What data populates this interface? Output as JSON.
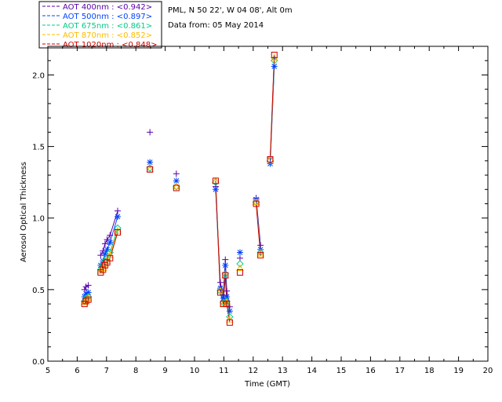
{
  "header": {
    "site": "PML, N 50 22', W 04 08', Alt 0m",
    "date_line": "Data from: 05 May 2014"
  },
  "legend": [
    {
      "label": "AOT  400nm : <0.942>",
      "color": "#5500aa"
    },
    {
      "label": "AOT  500nm : <0.897>",
      "color": "#0044ff"
    },
    {
      "label": "AOT  675nm : <0.861>",
      "color": "#00cc88"
    },
    {
      "label": "AOT  870nm : <0.852>",
      "color": "#ffbb00"
    },
    {
      "label": "AOT 1020nm : <0.848>",
      "color": "#cc0000"
    }
  ],
  "chart_data": {
    "type": "line",
    "xlabel": "Time (GMT)",
    "ylabel": "Aerosol Optical Thickness",
    "xlim": [
      5,
      20
    ],
    "ylim": [
      0.0,
      2.2
    ],
    "xticks": [
      "5",
      "6",
      "7",
      "8",
      "9",
      "10",
      "11",
      "12",
      "13",
      "14",
      "15",
      "16",
      "17",
      "18",
      "19",
      "20"
    ],
    "yticks": [
      "0.0",
      "0.5",
      "1.0",
      "1.5",
      "2.0"
    ],
    "series": [
      {
        "name": "AOT  400nm",
        "marker": "plus",
        "x": [
          6.25,
          6.3,
          6.38,
          6.8,
          6.88,
          6.95,
          7.02,
          7.12,
          7.38,
          8.48,
          9.38,
          10.72,
          10.88,
          10.98,
          11.05,
          11.1,
          11.2,
          11.55,
          12.1,
          12.25,
          12.58,
          12.72
        ],
        "y": [
          0.5,
          0.52,
          0.53,
          0.74,
          0.77,
          0.82,
          0.85,
          0.88,
          1.05,
          1.6,
          1.31,
          1.22,
          0.55,
          0.46,
          0.71,
          0.49,
          0.38,
          0.72,
          1.14,
          0.81,
          1.42,
          2.12
        ]
      },
      {
        "name": "AOT  500nm",
        "marker": "star",
        "x": [
          6.25,
          6.3,
          6.38,
          6.8,
          6.88,
          6.95,
          7.02,
          7.12,
          7.38,
          8.48,
          9.38,
          10.72,
          10.88,
          10.98,
          11.05,
          11.1,
          11.2,
          11.55,
          12.1,
          12.25,
          12.58,
          12.72
        ],
        "y": [
          0.45,
          0.47,
          0.48,
          0.67,
          0.7,
          0.75,
          0.78,
          0.83,
          1.01,
          1.39,
          1.26,
          1.2,
          0.51,
          0.44,
          0.67,
          0.45,
          0.35,
          0.76,
          1.13,
          0.78,
          1.38,
          2.06
        ]
      },
      {
        "name": "AOT  675nm",
        "marker": "diamond",
        "x": [
          6.25,
          6.3,
          6.38,
          6.8,
          6.88,
          6.95,
          7.02,
          7.12,
          7.38,
          8.48,
          9.38,
          10.72,
          10.88,
          10.98,
          11.05,
          11.1,
          11.2,
          11.55,
          12.1,
          12.25,
          12.58,
          12.72
        ],
        "y": [
          0.42,
          0.44,
          0.45,
          0.64,
          0.67,
          0.7,
          0.72,
          0.76,
          0.93,
          1.35,
          1.22,
          1.25,
          0.49,
          0.41,
          0.61,
          0.42,
          0.31,
          0.68,
          1.11,
          0.76,
          1.4,
          2.1
        ]
      },
      {
        "name": "AOT  870nm",
        "marker": "triangle",
        "x": [
          6.25,
          6.3,
          6.38,
          6.8,
          6.88,
          6.95,
          7.02,
          7.12,
          7.38,
          8.48,
          9.38,
          10.72,
          10.88,
          10.98,
          11.05,
          11.1,
          11.2,
          11.55,
          12.1,
          12.25,
          12.58,
          12.72
        ],
        "y": [
          0.41,
          0.43,
          0.44,
          0.63,
          0.65,
          0.68,
          0.7,
          0.74,
          0.91,
          1.34,
          1.22,
          1.26,
          0.49,
          0.4,
          0.6,
          0.41,
          0.29,
          0.65,
          1.11,
          0.75,
          1.41,
          2.12
        ]
      },
      {
        "name": "AOT 1020nm",
        "marker": "square",
        "x": [
          6.25,
          6.3,
          6.38,
          6.8,
          6.88,
          6.95,
          7.02,
          7.12,
          7.38,
          8.48,
          9.38,
          10.72,
          10.88,
          10.98,
          11.05,
          11.1,
          11.2,
          11.55,
          12.1,
          12.25,
          12.58,
          12.72
        ],
        "y": [
          0.4,
          0.42,
          0.43,
          0.62,
          0.64,
          0.67,
          0.69,
          0.72,
          0.9,
          1.34,
          1.21,
          1.26,
          0.48,
          0.4,
          0.6,
          0.4,
          0.27,
          0.62,
          1.1,
          0.74,
          1.41,
          2.14
        ]
      }
    ],
    "segments": [
      [
        0,
        2
      ],
      [
        3,
        8
      ],
      [
        11,
        16
      ],
      [
        18,
        19
      ],
      [
        20,
        21
      ]
    ]
  }
}
